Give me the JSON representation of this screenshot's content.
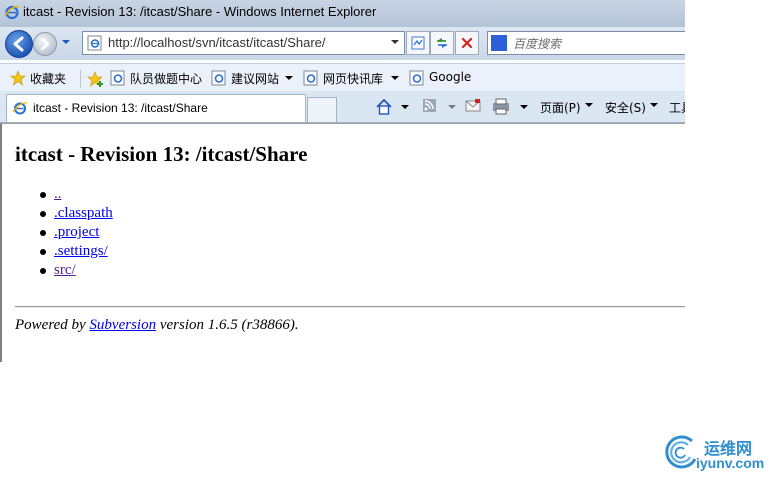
{
  "window": {
    "title": "itcast - Revision 13: /itcast/Share - Windows Internet Explorer"
  },
  "address_bar": {
    "url": "http://localhost/svn/itcast/itcast/Share/",
    "search_placeholder": "百度搜索"
  },
  "favorites_bar": {
    "favorites_label": "收藏夹",
    "links": [
      {
        "label": "队员做题中心",
        "has_dropdown": false
      },
      {
        "label": "建议网站",
        "has_dropdown": true
      },
      {
        "label": "网页快讯库",
        "has_dropdown": true
      },
      {
        "label": "Google",
        "has_dropdown": false
      }
    ]
  },
  "tab": {
    "title": "itcast - Revision 13: /itcast/Share"
  },
  "command_bar": {
    "page_menu": "页面(P)",
    "safety_menu": "安全(S)",
    "tools_menu": "工具"
  },
  "page": {
    "heading": "itcast - Revision 13: /itcast/Share",
    "entries": [
      {
        "name": "..",
        "visited": true
      },
      {
        "name": ".classpath",
        "visited": false
      },
      {
        "name": ".project",
        "visited": false
      },
      {
        "name": ".settings/",
        "visited": false
      },
      {
        "name": "src/",
        "visited": true
      }
    ],
    "footer": {
      "prefix": "Powered by ",
      "link": "Subversion",
      "suffix": " version 1.6.5 (r38866)."
    }
  },
  "watermark": {
    "cn": "运维网",
    "domain": "iyunv.com"
  },
  "colors": {
    "link": "#0000ee",
    "visited_link": "#551a8b",
    "watermark": "#2f8fd0"
  }
}
